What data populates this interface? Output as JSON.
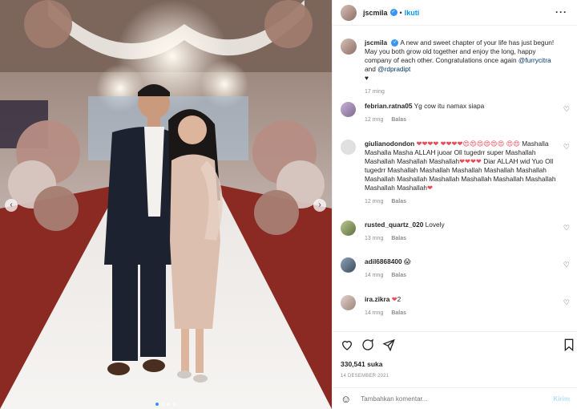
{
  "photo": {
    "prev_icon": "chevron-left-icon",
    "next_icon": "chevron-right-icon",
    "dots_count": 4
  },
  "header": {
    "username": "jscmila",
    "separator": "•",
    "follow_label": "Ikuti",
    "more_icon": "more-horizontal-icon"
  },
  "caption": {
    "username": "jscmila",
    "text_before": "A new and sweet chapter of your life has just begun! May you both grow old together and enjoy the long, happy company of each other. Congratulations once again ",
    "mention1": "@furrycitra",
    "and": " and ",
    "mention2": "@rdpradipt",
    "heart": "♥",
    "time": "17 ming"
  },
  "comments": [
    {
      "username": "febrian.ratna05",
      "text": "Yg cow itu namax siapa",
      "time": "12 mng",
      "reply": "Balas"
    },
    {
      "username": "giulianodondon",
      "emojis": "❤❤❤❤ ❤❤❤❤😍😍😍😍😍😍 😍😍",
      "text": " Mashalla Mashalla Masha ALLAH juoar Oll tugedrr super Mashallah Mashallah Mashallah Mashallah",
      "hearts2": "❤❤❤❤",
      "text2": " Diar ALLAH wid Yuo Oll tugedrr Mashallah Mashallah Mashallah Mashallah Mashallah Mashallah Mashallah Mashallah Mashallah Mashallah Mashallah Mashallah Mashallah",
      "heart_end": "❤",
      "time": "12 mng",
      "reply": "Balas"
    },
    {
      "username": "rusted_quartz_020",
      "text": "Lovely",
      "time": "13 mng",
      "reply": "Balas"
    },
    {
      "username": "adil6868400",
      "text": "😱",
      "time": "14 mng",
      "reply": "Balas"
    },
    {
      "username": "ira.zikra",
      "heart": "❤",
      "text": "2",
      "time": "14 mng",
      "reply": "Balas"
    }
  ],
  "actions": {
    "like_icon": "heart-outline-icon",
    "comment_icon": "comment-icon",
    "share_icon": "paper-plane-icon",
    "save_icon": "bookmark-icon"
  },
  "likes": "330,541 suka",
  "date": "14 DESEMBER 2021",
  "add_comment": {
    "emoji_icon": "smiley-icon",
    "placeholder": "Tambahkan komentar...",
    "post_label": "Kirim"
  },
  "colors": {
    "accent": "#0095f6",
    "verified": "#3897f0",
    "mention": "#00376b",
    "heart_red": "#ed4956",
    "muted": "#8e8e8e"
  }
}
